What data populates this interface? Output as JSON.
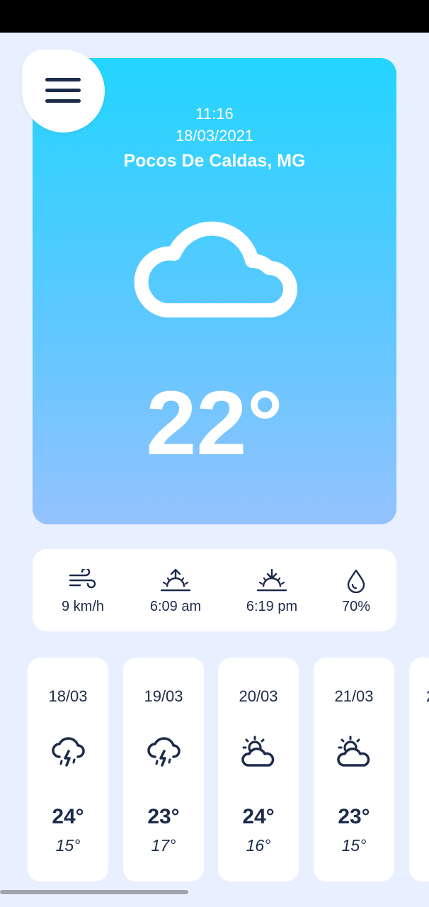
{
  "hero": {
    "time": "11:16",
    "date": "18/03/2021",
    "city": "Pocos De Caldas, MG",
    "condition_icon": "cloud-icon",
    "temperature": "22°"
  },
  "menu": {
    "icon": "hamburger-menu-icon"
  },
  "info": [
    {
      "name": "wind",
      "icon": "wind-icon",
      "value": "9 km/h"
    },
    {
      "name": "sunrise",
      "icon": "sunrise-icon",
      "value": "6:09 am"
    },
    {
      "name": "sunset",
      "icon": "sunset-icon",
      "value": "6:19 pm"
    },
    {
      "name": "humidity",
      "icon": "water-drop-icon",
      "value": "70%"
    }
  ],
  "forecast": [
    {
      "date": "18/03",
      "icon": "thunderstorm-icon",
      "max": "24°",
      "min": "15°"
    },
    {
      "date": "19/03",
      "icon": "thunderstorm-icon",
      "max": "23°",
      "min": "17°"
    },
    {
      "date": "20/03",
      "icon": "partly-cloudy-icon",
      "max": "24°",
      "min": "16°"
    },
    {
      "date": "21/03",
      "icon": "partly-cloudy-icon",
      "max": "23°",
      "min": "15°"
    },
    {
      "date": "2",
      "icon": "",
      "max": "",
      "min": ""
    }
  ],
  "colors": {
    "background": "#e8efff",
    "hero_top": "#23d5ff",
    "hero_bottom": "#94c2ff",
    "text_dark": "#1c2b4a"
  }
}
